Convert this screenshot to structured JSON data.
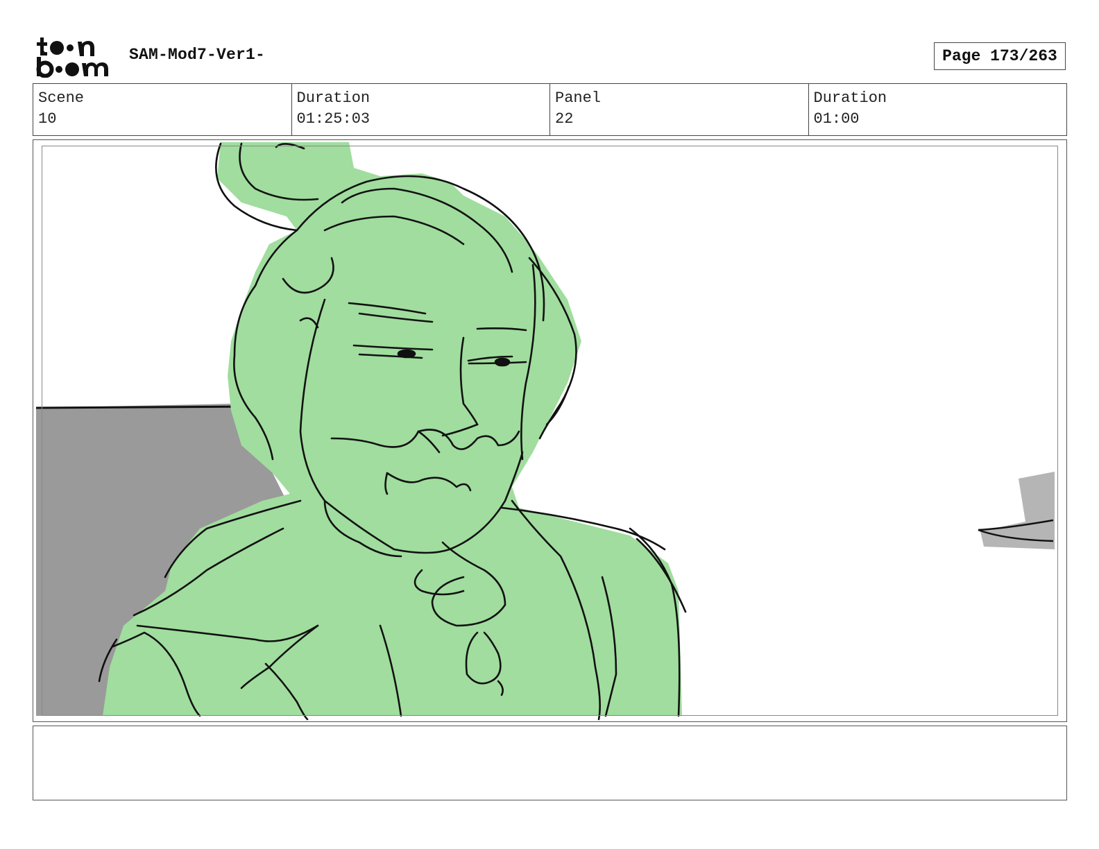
{
  "header": {
    "logo_text": "toonboom",
    "doc_title": "SAM-Mod7-Ver1-",
    "page_label": "Page 173/263"
  },
  "info": {
    "scene_label": "Scene",
    "scene_value": "10",
    "duration_label": "Duration",
    "duration_value": "01:25:03",
    "panel_label": "Panel",
    "panel_value": "22",
    "panel_duration_label": "Duration",
    "panel_duration_value": "01:00"
  },
  "notes": {
    "text": ""
  },
  "colors": {
    "figure_fill": "#a0dd9e",
    "background_grey": "#9a9a9a",
    "line": "#111111"
  }
}
